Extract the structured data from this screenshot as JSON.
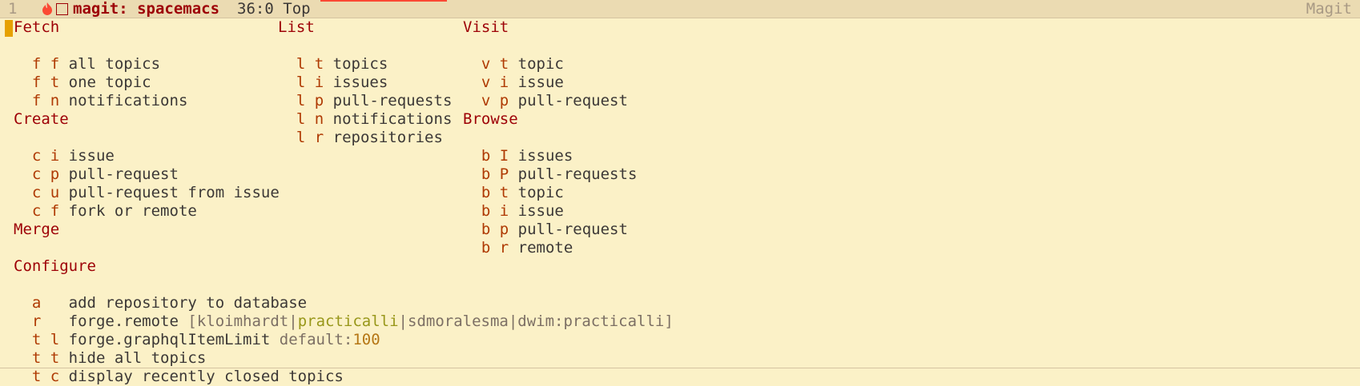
{
  "modeline": {
    "window_number": "1",
    "buffer_title": "magit: spacemacs",
    "position": "36:0",
    "position_label": "Top",
    "mode": "Magit"
  },
  "fetch": {
    "heading": "Fetch",
    "items": [
      {
        "keys": "f f",
        "label": "all topics"
      },
      {
        "keys": "f t",
        "label": "one topic"
      },
      {
        "keys": "f n",
        "label": "notifications"
      }
    ]
  },
  "list": {
    "heading": "List",
    "items": [
      {
        "keys": "l t",
        "label": "topics"
      },
      {
        "keys": "l i",
        "label": "issues"
      },
      {
        "keys": "l p",
        "label": "pull-requests"
      },
      {
        "keys": "l n",
        "label": "notifications"
      },
      {
        "keys": "l r",
        "label": "repositories"
      }
    ]
  },
  "visit": {
    "heading": "Visit",
    "items": [
      {
        "keys": "v t",
        "label": "topic"
      },
      {
        "keys": "v i",
        "label": "issue"
      },
      {
        "keys": "v p",
        "label": "pull-request"
      }
    ]
  },
  "create": {
    "heading": "Create",
    "items": [
      {
        "keys": "c i",
        "label": "issue"
      },
      {
        "keys": "c p",
        "label": "pull-request"
      },
      {
        "keys": "c u",
        "label": "pull-request from issue"
      },
      {
        "keys": "c f",
        "label": "fork or remote"
      }
    ]
  },
  "browse": {
    "heading": "Browse",
    "items": [
      {
        "keys": "b I",
        "label": "issues"
      },
      {
        "keys": "b P",
        "label": "pull-requests"
      },
      {
        "keys": "b t",
        "label": "topic"
      },
      {
        "keys": "b i",
        "label": "issue"
      },
      {
        "keys": "b p",
        "label": "pull-request"
      },
      {
        "keys": "b r",
        "label": "remote"
      }
    ]
  },
  "merge": {
    "heading": "Merge"
  },
  "configure": {
    "heading": "Configure",
    "add_repo": {
      "keys": "a",
      "label": "add repository to database"
    },
    "remote": {
      "keys": "r",
      "label": "forge.remote",
      "open": "[",
      "options": [
        "kloimhardt",
        "practicalli",
        "sdmoralesma",
        "dwim:practicalli"
      ],
      "sep": "|",
      "close": "]",
      "selected": "practicalli"
    },
    "limit": {
      "keys": "t l",
      "label": "forge.graphqlItemLimit",
      "default_label": "default:",
      "default_value": "100"
    },
    "hide": {
      "keys": "t t",
      "label": "hide all topics"
    },
    "closed": {
      "keys": "t c",
      "label": "display recently closed topics"
    }
  }
}
